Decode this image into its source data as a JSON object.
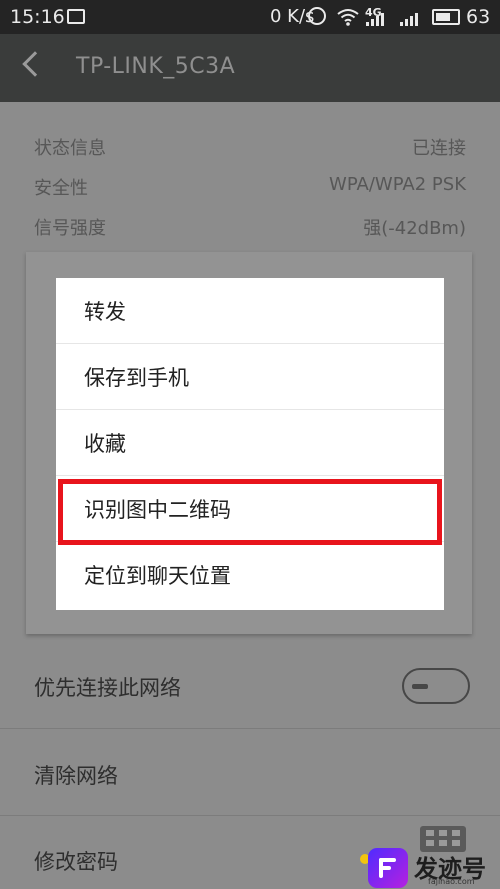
{
  "status_bar": {
    "time": "15:16",
    "net_speed": "0 K/s",
    "signal_label": "4G",
    "battery": "63"
  },
  "header": {
    "title": "TP-LINK_5C3A"
  },
  "info": [
    {
      "label": "状态信息",
      "value": "已连接"
    },
    {
      "label": "安全性",
      "value": "WPA/WPA2 PSK"
    },
    {
      "label": "信号强度",
      "value": "强(-42dBm)"
    }
  ],
  "settings": [
    {
      "label": "优先连接此网络"
    },
    {
      "label": "清除网络"
    },
    {
      "label": "修改密码"
    }
  ],
  "menu": {
    "items": [
      {
        "label": "转发"
      },
      {
        "label": "保存到手机"
      },
      {
        "label": "收藏"
      },
      {
        "label": "识别图中二维码"
      },
      {
        "label": "定位到聊天位置"
      }
    ]
  },
  "watermark": {
    "brand": "发迹号",
    "site": "fajihao.com"
  },
  "colors": {
    "highlight": "#e8141c",
    "header_bg": "#3a3c3b",
    "dim_bg": "#8c8c8c"
  }
}
